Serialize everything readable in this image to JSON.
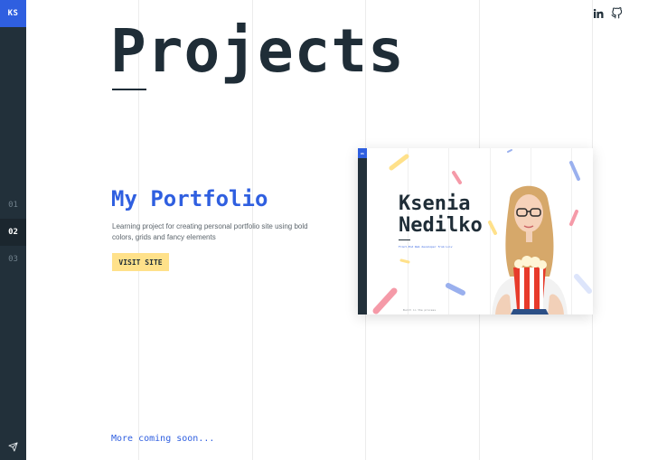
{
  "sidebar": {
    "logo": "KS",
    "numbers": [
      "01",
      "02",
      "03"
    ],
    "active_index": 1
  },
  "header": {
    "social_icons": [
      "linkedin-icon",
      "github-icon"
    ]
  },
  "main": {
    "title": "Projects",
    "project": {
      "name": "My Portfolio",
      "description": "Learning project for creating personal portfolio site using bold colors, grids and fancy elements",
      "button": "VISIT SITE",
      "preview": {
        "logo": "KS",
        "name_line1": "Ksenia",
        "name_line2": "Nedilko",
        "tagline": "Front-End Web developer from Lviv",
        "footer": "Built in the process"
      }
    },
    "more": "More coming soon..."
  },
  "colors": {
    "accent": "#2f5fe0",
    "sidebar": "#22303a",
    "button": "#ffe18a",
    "text": "#1f2d37"
  }
}
